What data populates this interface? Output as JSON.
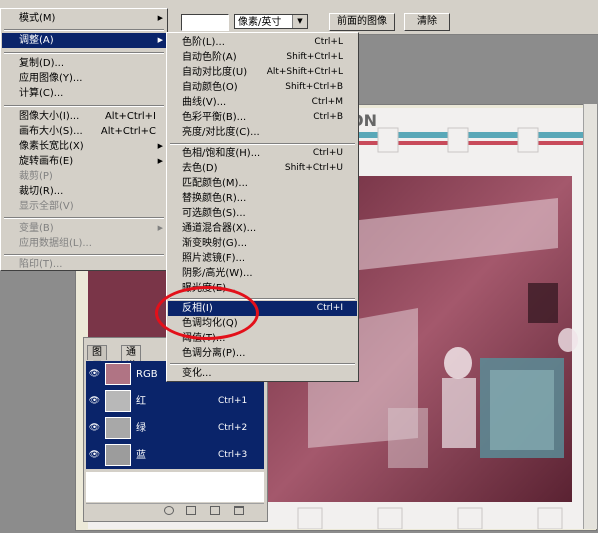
{
  "options_bar": {
    "unit_select": "像素/英寸",
    "front_image_button": "前面的图像",
    "clear_button": "清除"
  },
  "main_menu": {
    "items": [
      {
        "label": "模式(M)",
        "submenu": true
      },
      {
        "label": "调整(A)",
        "submenu": true,
        "highlighted": true
      },
      {
        "label": "复制(D)..."
      },
      {
        "label": "应用图像(Y)..."
      },
      {
        "label": "计算(C)..."
      },
      {
        "label": "图像大小(I)...",
        "shortcut": "Alt+Ctrl+I"
      },
      {
        "label": "画布大小(S)...",
        "shortcut": "Alt+Ctrl+C"
      },
      {
        "label": "像素长宽比(X)",
        "submenu": true
      },
      {
        "label": "旋转画布(E)",
        "submenu": true
      },
      {
        "label": "裁剪(P)",
        "disabled": true
      },
      {
        "label": "裁切(R)..."
      },
      {
        "label": "显示全部(V)",
        "disabled": true
      },
      {
        "label": "变量(B)",
        "submenu": true,
        "disabled": true
      },
      {
        "label": "应用数据组(L)...",
        "disabled": true
      },
      {
        "label": "陷印(T)...",
        "disabled": true
      }
    ]
  },
  "adjust_submenu": {
    "items": [
      {
        "label": "色阶(L)...",
        "shortcut": "Ctrl+L"
      },
      {
        "label": "自动色阶(A)",
        "shortcut": "Shift+Ctrl+L"
      },
      {
        "label": "自动对比度(U)",
        "shortcut": "Alt+Shift+Ctrl+L"
      },
      {
        "label": "自动颜色(O)",
        "shortcut": "Shift+Ctrl+B"
      },
      {
        "label": "曲线(V)...",
        "shortcut": "Ctrl+M"
      },
      {
        "label": "色彩平衡(B)...",
        "shortcut": "Ctrl+B"
      },
      {
        "label": "亮度/对比度(C)..."
      },
      {
        "label": "色相/饱和度(H)...",
        "shortcut": "Ctrl+U"
      },
      {
        "label": "去色(D)",
        "shortcut": "Shift+Ctrl+U"
      },
      {
        "label": "匹配颜色(M)..."
      },
      {
        "label": "替换颜色(R)..."
      },
      {
        "label": "可选颜色(S)..."
      },
      {
        "label": "通道混合器(X)..."
      },
      {
        "label": "渐变映射(G)..."
      },
      {
        "label": "照片滤镜(F)..."
      },
      {
        "label": "阴影/高光(W)..."
      },
      {
        "label": "曝光度(E)..."
      },
      {
        "label": "反相(I)",
        "shortcut": "Ctrl+I",
        "highlighted": true
      },
      {
        "label": "色调均化(Q)"
      },
      {
        "label": "阈值(T)..."
      },
      {
        "label": "色调分离(P)..."
      },
      {
        "label": "变化..."
      }
    ]
  },
  "channels_panel": {
    "tabs": [
      "图层",
      "通道"
    ],
    "channels": [
      {
        "name": "RGB",
        "shortcut": ""
      },
      {
        "name": "红",
        "shortcut": "Ctrl+1"
      },
      {
        "name": "绿",
        "shortcut": "Ctrl+2"
      },
      {
        "name": "蓝",
        "shortcut": "Ctrl+3"
      }
    ]
  },
  "document": {
    "film_strip_text": "ON"
  },
  "colors": {
    "menu_bg": "#d4d0c8",
    "selection": "#0a246a",
    "annotation": "#e3101a"
  }
}
